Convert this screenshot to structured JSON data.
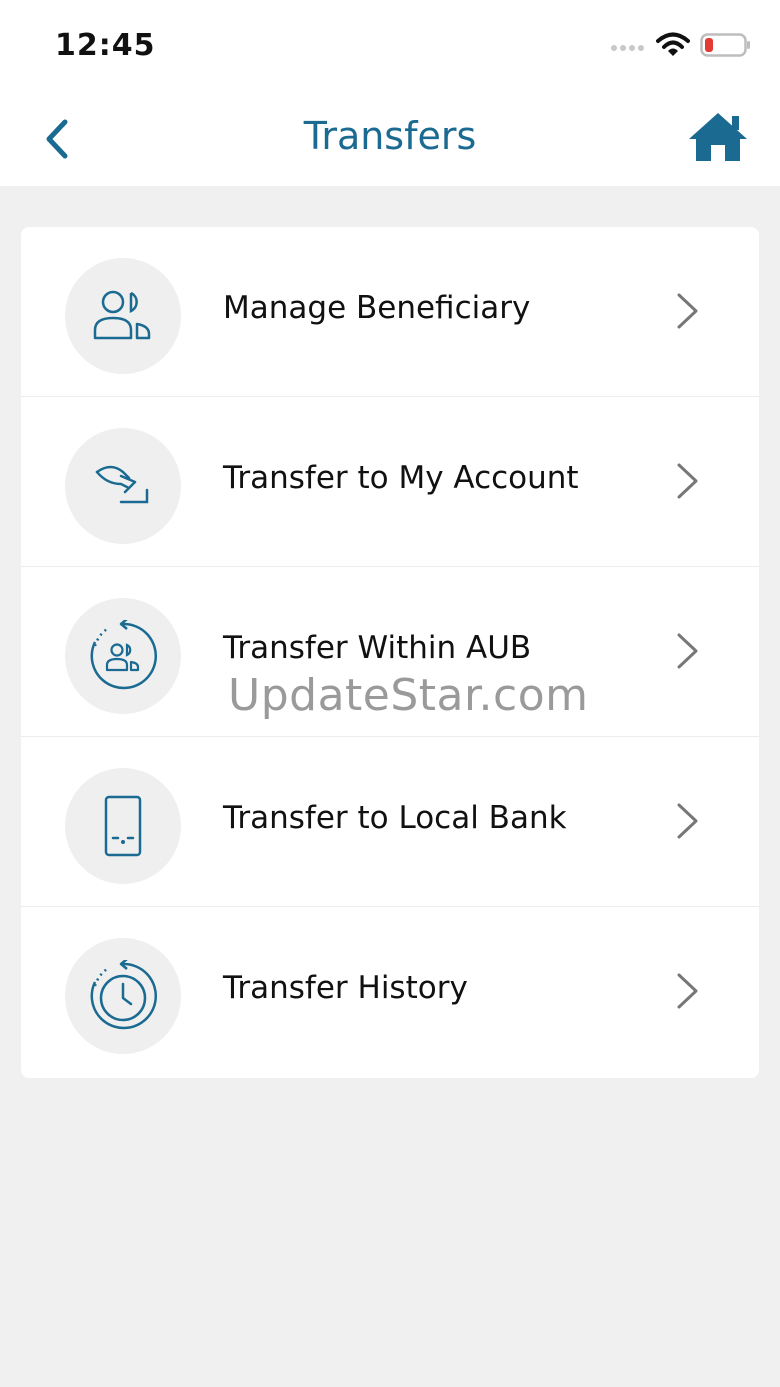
{
  "status_bar": {
    "time": "12:45"
  },
  "nav": {
    "title": "Transfers",
    "back_icon": "chevron-left-icon",
    "home_icon": "home-icon"
  },
  "menu": {
    "items": [
      {
        "label": "Manage Beneficiary",
        "icon": "users-icon"
      },
      {
        "label": "Transfer to My Account",
        "icon": "transfer-arrow-icon"
      },
      {
        "label": "Transfer Within AUB",
        "icon": "users-rotate-icon"
      },
      {
        "label": "Transfer to Local Bank",
        "icon": "mobile-icon"
      },
      {
        "label": "Transfer History",
        "icon": "clock-history-icon"
      }
    ]
  },
  "watermark": "UpdateStar.com",
  "colors": {
    "accent": "#1a6a92",
    "background": "#f0f0f0",
    "card": "#ffffff",
    "battery_low": "#e53935"
  }
}
